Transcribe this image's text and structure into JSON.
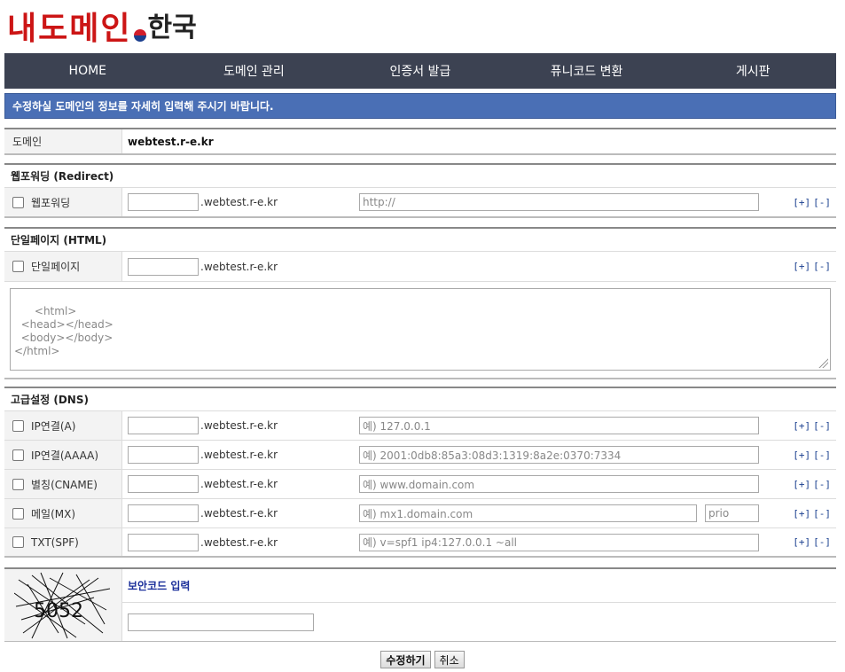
{
  "logo": {
    "brand": "내도메인",
    "tld": "한국"
  },
  "nav": [
    {
      "label": "HOME"
    },
    {
      "label": "도메인 관리"
    },
    {
      "label": "인증서 발급"
    },
    {
      "label": "퓨니코드 변환"
    },
    {
      "label": "게시판"
    }
  ],
  "notice": "수정하실 도메인의 정보를 자세히 입력해 주시기 바랍니다.",
  "domain": {
    "label": "도메인",
    "value": "webtest.r-e.kr"
  },
  "redirect": {
    "header": "웹포워딩 (Redirect)",
    "label": "웹포워딩",
    "suffix": ".webtest.r-e.kr",
    "url_placeholder": "http://"
  },
  "html_page": {
    "header": "단일페이지 (HTML)",
    "label": "단일페이지",
    "suffix": ".webtest.r-e.kr",
    "content": "<html>\n  <head></head>\n  <body></body>\n</html>"
  },
  "dns": {
    "header": "고급설정 (DNS)",
    "records": [
      {
        "label": "IP연결(A)",
        "suffix": ".webtest.r-e.kr",
        "placeholder": "예) 127.0.0.1"
      },
      {
        "label": "IP연결(AAAA)",
        "suffix": ".webtest.r-e.kr",
        "placeholder": "예) 2001:0db8:85a3:08d3:1319:8a2e:0370:7334"
      },
      {
        "label": "별칭(CNAME)",
        "suffix": ".webtest.r-e.kr",
        "placeholder": "예) www.domain.com"
      },
      {
        "label": "메일(MX)",
        "suffix": ".webtest.r-e.kr",
        "placeholder": "예) mx1.domain.com",
        "prio_placeholder": "prio"
      },
      {
        "label": "TXT(SPF)",
        "suffix": ".webtest.r-e.kr",
        "placeholder": "예) v=spf1 ip4:127.0.0.1 ~all"
      }
    ]
  },
  "controls": {
    "add": "[+]",
    "remove": "[-]"
  },
  "captcha": {
    "title": "보안코드 입력",
    "code": "5052"
  },
  "buttons": {
    "submit": "수정하기",
    "cancel": "취소"
  }
}
